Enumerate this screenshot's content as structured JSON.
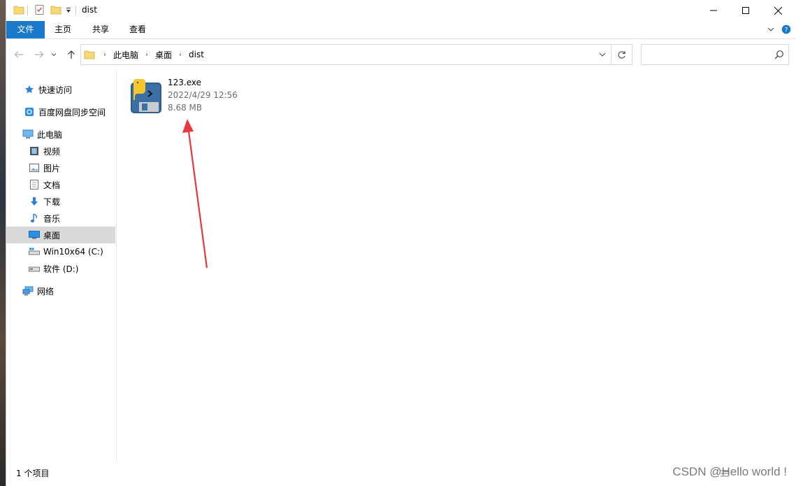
{
  "window": {
    "title": "dist"
  },
  "ribbon": {
    "tabs": [
      {
        "label": "文件",
        "active": true
      },
      {
        "label": "主页"
      },
      {
        "label": "共享"
      },
      {
        "label": "查看"
      }
    ]
  },
  "address": {
    "crumbs": [
      "此电脑",
      "桌面",
      "dist"
    ],
    "search_placeholder": ""
  },
  "navpane": {
    "items": [
      {
        "label": "快速访问",
        "icon": "star-icon"
      },
      {
        "label": "百度网盘同步空间",
        "icon": "cloud-sync-icon"
      },
      {
        "label": "此电脑",
        "icon": "computer-icon"
      },
      {
        "label": "视频",
        "icon": "video-icon"
      },
      {
        "label": "图片",
        "icon": "picture-icon"
      },
      {
        "label": "文档",
        "icon": "document-icon"
      },
      {
        "label": "下载",
        "icon": "download-icon"
      },
      {
        "label": "音乐",
        "icon": "music-icon"
      },
      {
        "label": "桌面",
        "icon": "desktop-icon",
        "selected": true
      },
      {
        "label": "Win10x64 (C:)",
        "icon": "system-drive-icon"
      },
      {
        "label": "软件 (D:)",
        "icon": "drive-icon"
      },
      {
        "label": "网络",
        "icon": "network-icon"
      }
    ]
  },
  "files": [
    {
      "name": "123.exe",
      "modified": "2022/4/29 12:56",
      "size": "8.68 MB",
      "icon": "python-exe-icon"
    }
  ],
  "status": {
    "count": "1 个项目"
  },
  "watermark": "CSDN @Hello  world !",
  "colors": {
    "accent": "#1979ca",
    "selection": "#d9d9d9",
    "annotation_arrow": "#e8383d"
  }
}
